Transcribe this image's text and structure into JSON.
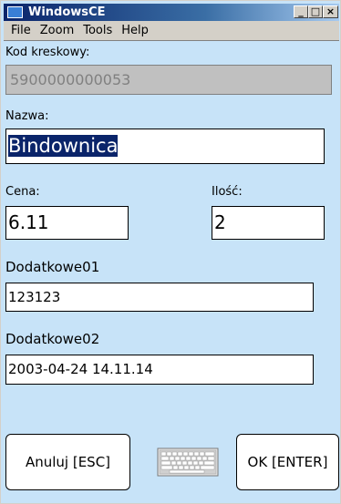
{
  "window": {
    "title": "WindowsCE",
    "minimize_glyph": "_",
    "maximize_glyph": "□",
    "close_glyph": "×"
  },
  "menu": {
    "items": [
      "File",
      "Zoom",
      "Tools",
      "Help"
    ]
  },
  "form": {
    "barcode_label": "Kod kreskowy:",
    "barcode_value": "5900000000053",
    "name_label": "Nazwa:",
    "name_value": "Bindownica",
    "price_label": "Cena:",
    "price_value": "6.11",
    "qty_label": "Ilość:",
    "qty_value": "2",
    "extra1_label": "Dodatkowe01",
    "extra1_value": "123123",
    "extra2_label": "Dodatkowe02",
    "extra2_value": "2003-04-24 14.11.14"
  },
  "buttons": {
    "cancel_label": "Anuluj [ESC]",
    "ok_label": "OK  [ENTER]"
  },
  "icons": {
    "window_icon": "app-window-icon",
    "keyboard_icon": "keyboard-icon"
  },
  "colors": {
    "client_background": "#c7e3f8",
    "title_bar": "#0a246a",
    "selection": "#0a246a",
    "disabled_field": "#c0c0c0"
  }
}
